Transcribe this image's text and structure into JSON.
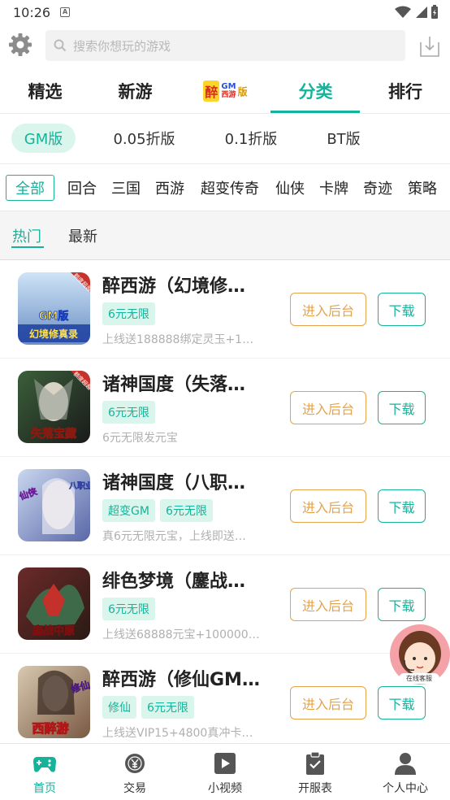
{
  "status_bar": {
    "time": "10:26",
    "notification_icon": "A"
  },
  "search": {
    "placeholder": "搜索你想玩的游戏"
  },
  "main_tabs": [
    {
      "label": "精选"
    },
    {
      "label": "新游"
    },
    {
      "label": "GM版",
      "logo": true
    },
    {
      "label": "分类",
      "active": true
    },
    {
      "label": "排行"
    }
  ],
  "gm_logo": {
    "zui": "醉",
    "gm": "GM",
    "extra": "西游",
    "ban": "版"
  },
  "versions": [
    {
      "label": "GM版",
      "active": true
    },
    {
      "label": "0.05折版"
    },
    {
      "label": "0.1折版"
    },
    {
      "label": "BT版"
    }
  ],
  "categories": [
    {
      "label": "全部",
      "active": true
    },
    {
      "label": "回合"
    },
    {
      "label": "三国"
    },
    {
      "label": "西游"
    },
    {
      "label": "超变传奇"
    },
    {
      "label": "仙侠"
    },
    {
      "label": "卡牌"
    },
    {
      "label": "奇迹"
    },
    {
      "label": "策略"
    }
  ],
  "sort": [
    {
      "label": "热门",
      "active": true
    },
    {
      "label": "最新"
    }
  ],
  "buttons": {
    "backend": "进入后台",
    "download": "下载"
  },
  "games": [
    {
      "title": "醉西游（幻境修…",
      "tags": [
        "6元无限"
      ],
      "desc": "上线送188888绑定灵玉+1…",
      "icon_text": "幻境修真录",
      "icon_badge": "GM版",
      "corner": "额度超越"
    },
    {
      "title": "诸神国度（失落…",
      "tags": [
        "6元无限"
      ],
      "desc": "6元无限发元宝",
      "icon_text": "失落宝藏",
      "icon_badge": "",
      "corner": "额度超越"
    },
    {
      "title": "诸神国度（八职…",
      "tags": [
        "超变GM",
        "6元无限"
      ],
      "desc": "真6元无限元宝，上线即送…",
      "icon_text": "八职业",
      "icon_badge": "仙侠",
      "corner": ""
    },
    {
      "title": "绯色梦境（鏖战…",
      "tags": [
        "6元无限"
      ],
      "desc": "上线送68888元宝+100000…",
      "icon_text": "鏖战中原",
      "icon_badge": "",
      "corner": ""
    },
    {
      "title": "醉西游（修仙GM…",
      "tags": [
        "修仙",
        "6元无限"
      ],
      "desc": "上线送VIP15+4800真冲卡…",
      "icon_text": "西醉游",
      "icon_badge": "修仙",
      "corner": ""
    }
  ],
  "service": {
    "label": "在线客服"
  },
  "bottom_nav": [
    {
      "label": "首页",
      "active": true,
      "icon": "gamepad-icon"
    },
    {
      "label": "交易",
      "icon": "coin-icon"
    },
    {
      "label": "小视频",
      "icon": "play-icon"
    },
    {
      "label": "开服表",
      "icon": "clipboard-icon"
    },
    {
      "label": "个人中心",
      "icon": "user-icon"
    }
  ],
  "colors": {
    "accent": "#16b39a",
    "accent_light": "#d9f5ec",
    "orange": "#e6a24a"
  }
}
